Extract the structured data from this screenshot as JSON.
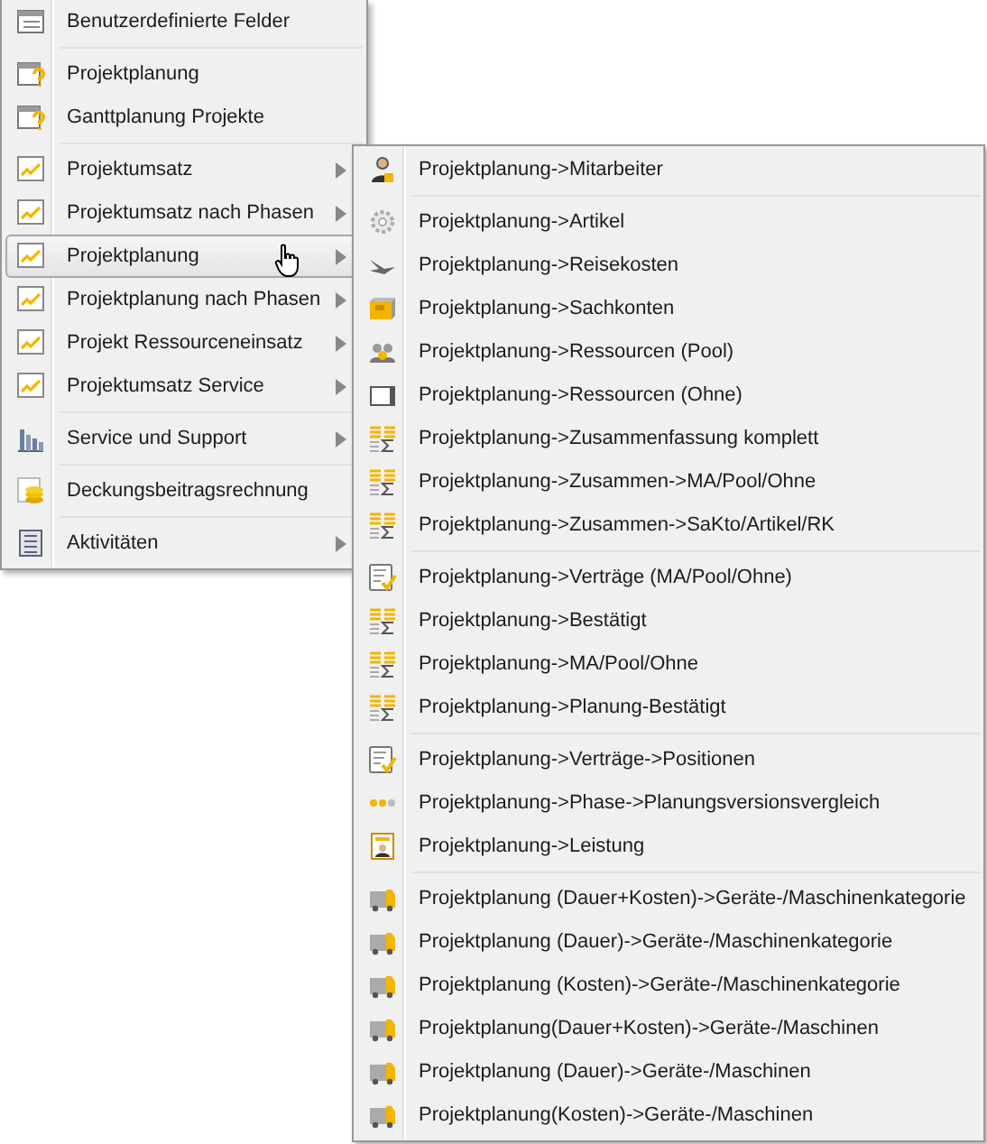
{
  "menu": {
    "groups": [
      {
        "items": [
          {
            "kind": "fields",
            "label": "Benutzerdefinierte Felder",
            "has_submenu": false,
            "selected": false
          }
        ]
      },
      {
        "items": [
          {
            "kind": "gantt",
            "label": "Projektplanung",
            "has_submenu": false,
            "selected": false
          },
          {
            "kind": "gantt",
            "label": "Ganttplanung Projekte",
            "has_submenu": false,
            "selected": false
          }
        ]
      },
      {
        "items": [
          {
            "kind": "chart",
            "label": "Projektumsatz",
            "has_submenu": true,
            "selected": false
          },
          {
            "kind": "chart",
            "label": "Projektumsatz nach Phasen",
            "has_submenu": true,
            "selected": false
          },
          {
            "kind": "chart",
            "label": "Projektplanung",
            "has_submenu": true,
            "selected": true
          },
          {
            "kind": "chart",
            "label": "Projektplanung nach Phasen",
            "has_submenu": true,
            "selected": false
          },
          {
            "kind": "chart",
            "label": "Projekt Ressourceneinsatz",
            "has_submenu": true,
            "selected": false
          },
          {
            "kind": "chart",
            "label": "Projektumsatz Service",
            "has_submenu": true,
            "selected": false
          }
        ]
      },
      {
        "items": [
          {
            "kind": "bars",
            "label": "Service und Support",
            "has_submenu": true,
            "selected": false
          }
        ]
      },
      {
        "items": [
          {
            "kind": "coins",
            "label": "Deckungsbeitragsrechnung",
            "has_submenu": false,
            "selected": false
          }
        ]
      },
      {
        "items": [
          {
            "kind": "list",
            "label": "Aktivitäten",
            "has_submenu": true,
            "selected": false
          }
        ]
      }
    ]
  },
  "submenu": {
    "groups": [
      {
        "items": [
          {
            "kind": "person",
            "label": "Projektplanung->Mitarbeiter",
            "selected": false
          }
        ]
      },
      {
        "items": [
          {
            "kind": "gear",
            "label": "Projektplanung->Artikel",
            "selected": false
          },
          {
            "kind": "plane",
            "label": "Projektplanung->Reisekosten",
            "selected": false
          },
          {
            "kind": "box",
            "label": "Projektplanung->Sachkonten",
            "selected": false
          },
          {
            "kind": "pool",
            "label": "Projektplanung->Ressourcen (Pool)",
            "selected": false
          },
          {
            "kind": "frame",
            "label": "Projektplanung->Ressourcen (Ohne)",
            "selected": false
          },
          {
            "kind": "sum",
            "label": "Projektplanung->Zusammenfassung komplett",
            "selected": false
          },
          {
            "kind": "sum",
            "label": "Projektplanung->Zusammen->MA/Pool/Ohne",
            "selected": false
          },
          {
            "kind": "sum",
            "label": "Projektplanung->Zusammen->SaKto/Artikel/RK",
            "selected": false
          }
        ]
      },
      {
        "items": [
          {
            "kind": "check",
            "label": "Projektplanung->Verträge (MA/Pool/Ohne)",
            "selected": false
          },
          {
            "kind": "sum",
            "label": "Projektplanung->Bestätigt",
            "selected": false
          },
          {
            "kind": "sum",
            "label": "Projektplanung->MA/Pool/Ohne",
            "selected": false
          },
          {
            "kind": "sum",
            "label": "Projektplanung->Planung-Bestätigt",
            "selected": false
          }
        ]
      },
      {
        "items": [
          {
            "kind": "check",
            "label": "Projektplanung->Verträge->Positionen",
            "selected": false
          },
          {
            "kind": "dots",
            "label": "Projektplanung->Phase->Planungsversionsvergleich",
            "selected": false
          },
          {
            "kind": "badge",
            "label": "Projektplanung->Leistung",
            "selected": false
          }
        ]
      },
      {
        "items": [
          {
            "kind": "truck",
            "label": "Projektplanung (Dauer+Kosten)->Geräte-/Maschinenkategorie",
            "selected": false
          },
          {
            "kind": "truck",
            "label": "Projektplanung (Dauer)->Geräte-/Maschinenkategorie",
            "selected": false
          },
          {
            "kind": "truck",
            "label": "Projektplanung (Kosten)->Geräte-/Maschinenkategorie",
            "selected": false
          },
          {
            "kind": "truck",
            "label": "Projektplanung(Dauer+Kosten)->Geräte-/Maschinen",
            "selected": false
          },
          {
            "kind": "truck",
            "label": "Projektplanung (Dauer)->Geräte-/Maschinen",
            "selected": false
          },
          {
            "kind": "truck",
            "label": "Projektplanung(Kosten)->Geräte-/Maschinen",
            "selected": false
          }
        ]
      }
    ]
  }
}
